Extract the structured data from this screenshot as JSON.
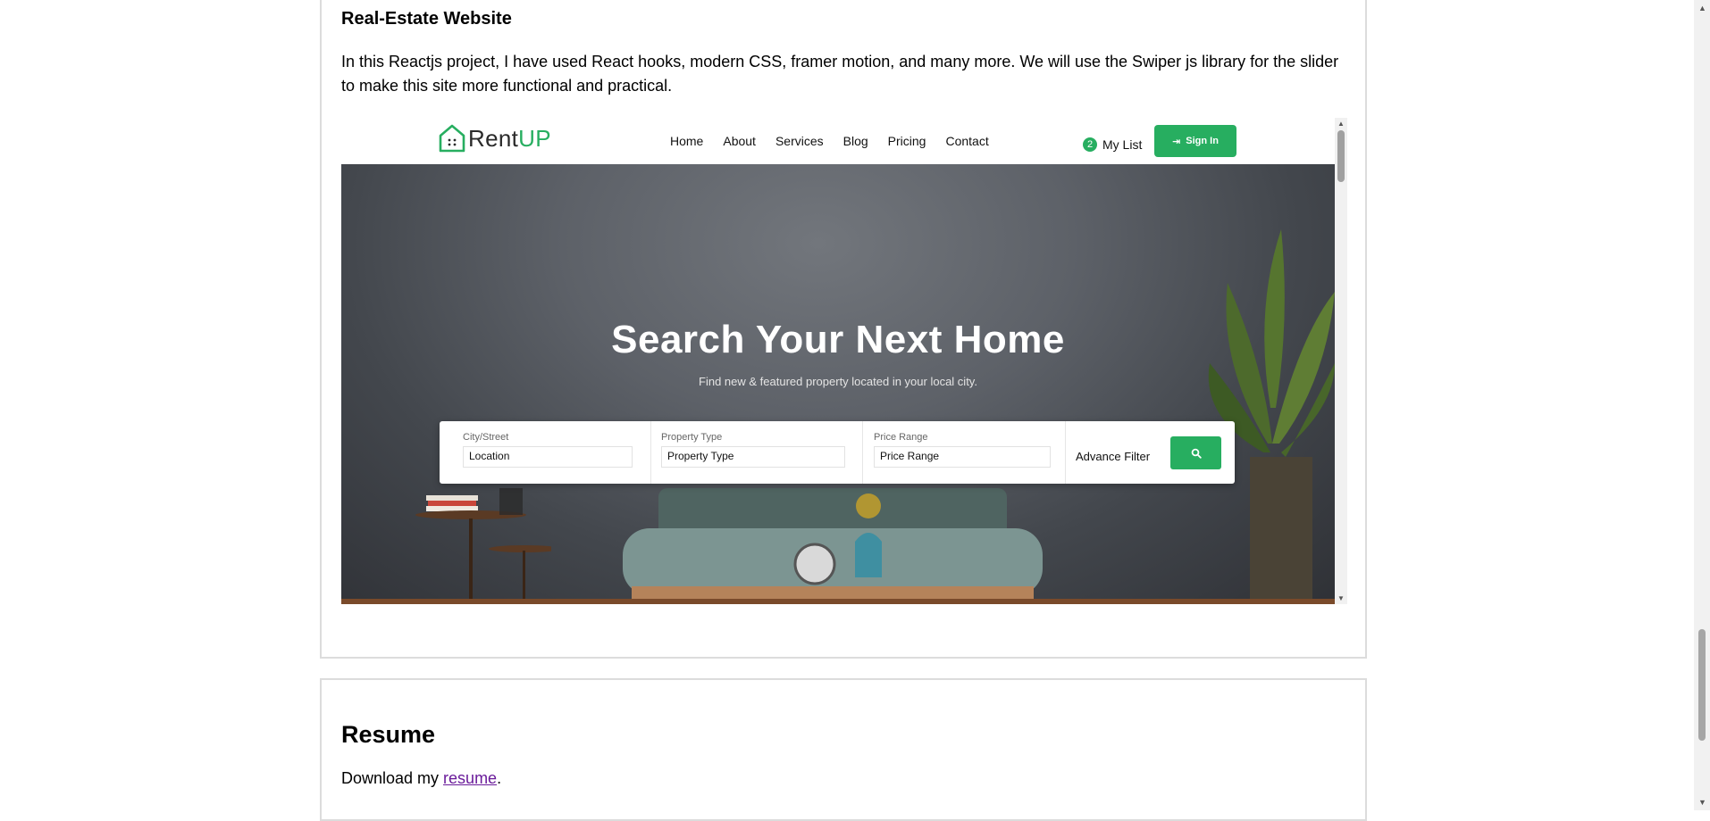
{
  "project": {
    "title": "Real-Estate Website",
    "description": "In this Reactjs project, I have used React hooks, modern CSS, framer motion, and many more. We will use the Swiper js library for the slider to make this site more functional and practical."
  },
  "preview": {
    "logo": {
      "text_part1": "Rent",
      "text_part2": "UP",
      "icon": "house-icon"
    },
    "nav": [
      "Home",
      "About",
      "Services",
      "Blog",
      "Pricing",
      "Contact"
    ],
    "mylist": {
      "count": "2",
      "label": "My List"
    },
    "signin_label": "Sign In",
    "hero": {
      "title": "Search Your Next Home",
      "subtitle": "Find new & featured property located in your local city."
    },
    "search": {
      "fields": [
        {
          "label": "City/Street",
          "value": "Location"
        },
        {
          "label": "Property Type",
          "value": "Property Type"
        },
        {
          "label": "Price Range",
          "value": "Price Range"
        }
      ],
      "advance_filter": "Advance Filter",
      "search_icon": "search-icon"
    },
    "accent_color": "#27ae60"
  },
  "resume": {
    "title": "Resume",
    "text_before": "Download my ",
    "link": "resume",
    "text_after": "."
  }
}
